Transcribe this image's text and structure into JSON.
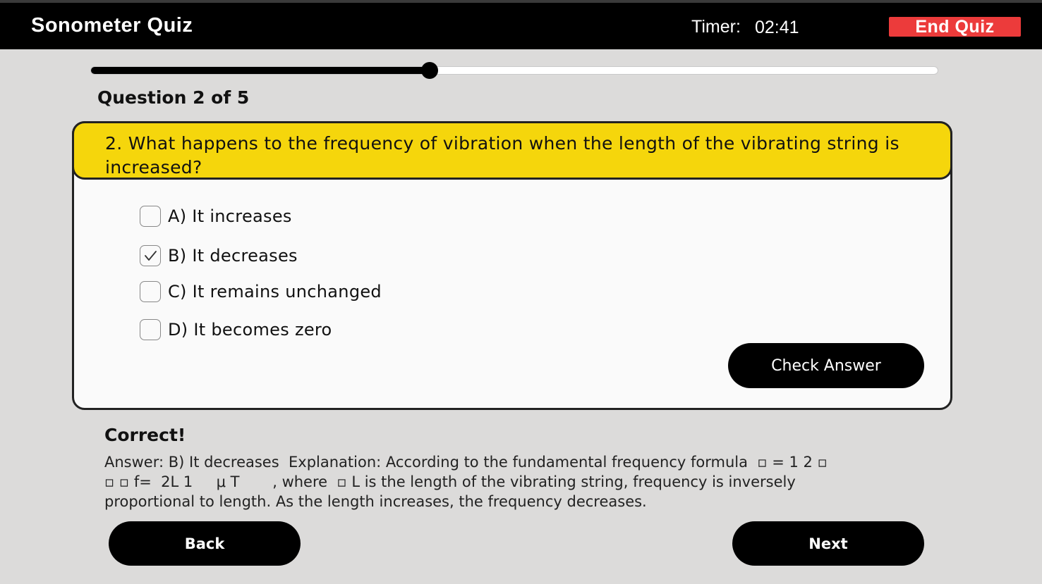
{
  "header": {
    "title": "Sonometer Quiz",
    "timer_label": "Timer:",
    "timer_value": "02:41",
    "end_quiz_label": "End Quiz",
    "end_quiz_color": "#ec3b3b"
  },
  "progress": {
    "fraction": 0.4
  },
  "question": {
    "counter": "Question 2 of 5",
    "text": "2. What happens to the frequency of vibration when the length of the vibrating string is increased?",
    "band_color": "#f5d60c"
  },
  "options": [
    {
      "label": "A) It increases",
      "checked": false
    },
    {
      "label": "B) It decreases",
      "checked": true
    },
    {
      "label": "C) It remains unchanged",
      "checked": false
    },
    {
      "label": "D) It becomes zero",
      "checked": false
    }
  ],
  "check_answer_label": "Check Answer",
  "feedback": {
    "title": "Correct!",
    "line1": "Answer: B) It decreases  Explanation: According to the fundamental frequency formula  ▫ = 1 2 ▫",
    "line2": "▫ ▫ f=  2L 1     μ T       , where  ▫ L is the length of the vibrating string, frequency is inversely",
    "line3": "proportional to length. As the length increases, the frequency decreases."
  },
  "nav": {
    "back_label": "Back",
    "next_label": "Next"
  }
}
